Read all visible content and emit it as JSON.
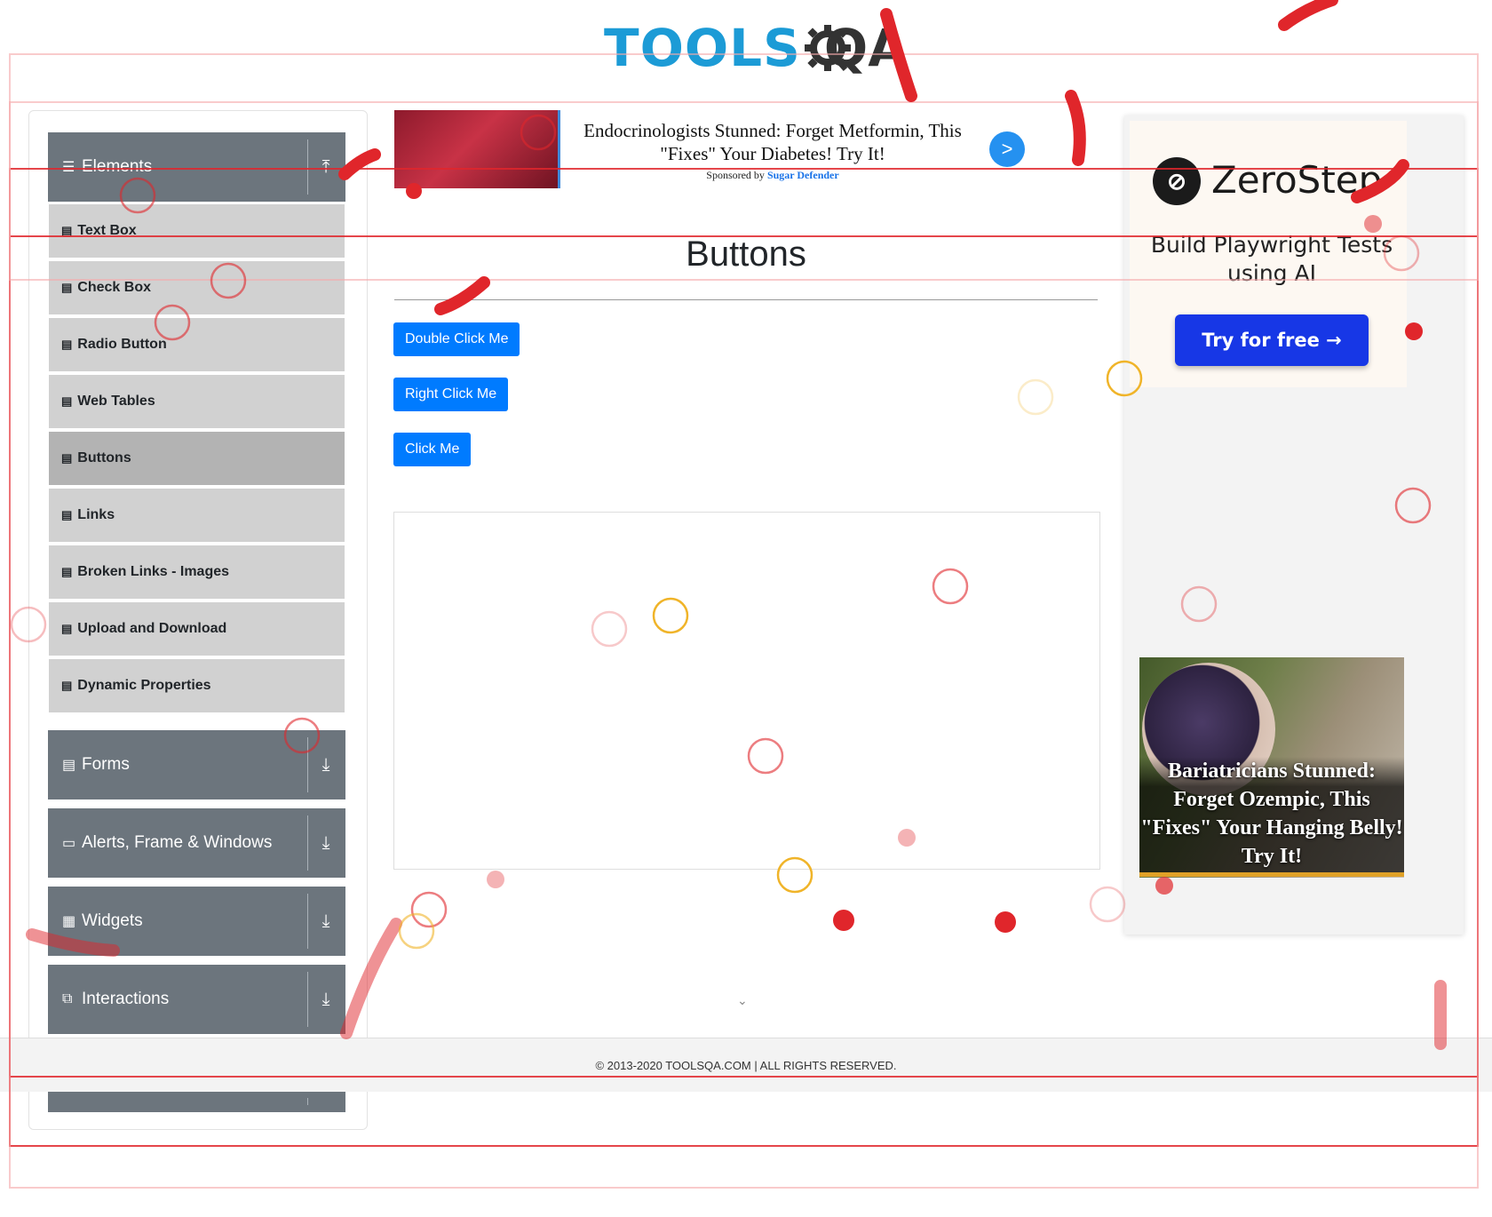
{
  "logo": {
    "brand_left": "TOOLS",
    "brand_right": "QA"
  },
  "sidebar": {
    "groups": [
      {
        "label": "Elements",
        "icon": "hamburger-icon",
        "chevron": "⤒"
      },
      {
        "label": "Forms",
        "icon": "document-icon",
        "chevron": "⤓"
      },
      {
        "label": "Alerts, Frame & Windows",
        "icon": "window-icon",
        "chevron": "⤓"
      },
      {
        "label": "Widgets",
        "icon": "widgets-icon",
        "chevron": "⤓"
      },
      {
        "label": "Interactions",
        "icon": "interactions-icon",
        "chevron": "⤓"
      }
    ],
    "items": [
      {
        "label": "Text Box"
      },
      {
        "label": "Check Box"
      },
      {
        "label": "Radio Button"
      },
      {
        "label": "Web Tables"
      },
      {
        "label": "Buttons"
      },
      {
        "label": "Links"
      },
      {
        "label": "Broken Links - Images"
      },
      {
        "label": "Upload and Download"
      },
      {
        "label": "Dynamic Properties"
      }
    ]
  },
  "ad_top": {
    "headline": "Endocrinologists Stunned: Forget Metformin, This \"Fixes\" Your Diabetes! Try It!",
    "sponsored_prefix": "Sponsored by",
    "sponsor": "Sugar Defender",
    "go_label": ">"
  },
  "main": {
    "title": "Buttons",
    "buttons": {
      "double_click": "Double Click Me",
      "right_click": "Right Click Me",
      "click": "Click Me"
    }
  },
  "ad_right": {
    "brand": "ZeroStep",
    "tagline": "Build Playwright Tests using AI",
    "cta": "Try for free →",
    "promo": "Bariatricians Stunned: Forget Ozempic, This \"Fixes\" Your Hanging Belly! Try It!"
  },
  "footer": {
    "copyright": "© 2013-2020 TOOLSQA.COM | ALL RIGHTS RESERVED."
  },
  "colors": {
    "primary": "#007bff",
    "sidebar_header": "#6c757d",
    "sidebar_item": "#d1d1d1",
    "sidebar_active": "#b3b3b3",
    "brand_blue": "#1c9bd6"
  }
}
